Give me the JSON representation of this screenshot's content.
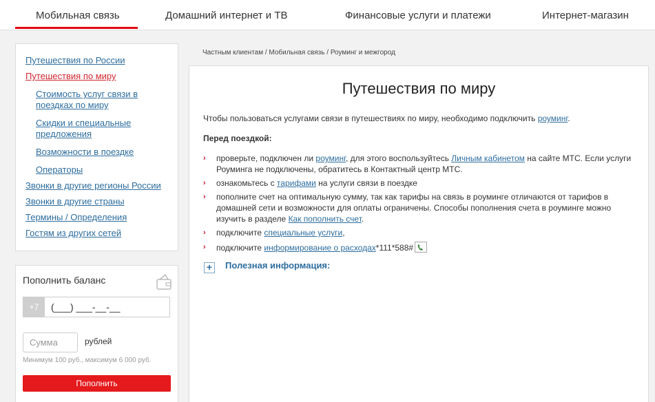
{
  "topnav": {
    "tabs": [
      {
        "label": "Мобильная связь"
      },
      {
        "label": "Домашний интернет и ТВ"
      },
      {
        "label": "Финансовые услуги и платежи"
      },
      {
        "label": "Интернет-магазин"
      }
    ]
  },
  "sidebar": {
    "items": [
      {
        "label": "Путешествия по России"
      },
      {
        "label": "Путешествия по миру"
      },
      {
        "label": "Стоимость услуг связи в поездках по миру"
      },
      {
        "label": "Скидки и специальные предложения"
      },
      {
        "label": "Возможности в поездке"
      },
      {
        "label": "Операторы"
      },
      {
        "label": "Звонки в другие регионы России"
      },
      {
        "label": "Звонки в другие страны"
      },
      {
        "label": "Термины / Определения"
      },
      {
        "label": "Гостям из других сетей"
      }
    ]
  },
  "balance": {
    "title": "Пополнить баланс",
    "prefix": "+7",
    "phone_mask": "(___) ___-__-__",
    "sum_placeholder": "Сумма",
    "currency": "рублей",
    "hint": "Минимум 100 руб., максимум 6 000 руб.",
    "button": "Пополнить"
  },
  "breadcrumb": {
    "items": [
      "Частным клиентам",
      "Мобильная связь",
      "Роуминг и межгород"
    ],
    "separator": " / "
  },
  "content": {
    "title": "Путешествия по миру",
    "intro": {
      "text": "Чтобы пользоваться услугами связи в путешествиях по миру, необходимо подключить ",
      "link": "роуминг",
      "end": "."
    },
    "before_title": "Перед поездкой:",
    "item1": {
      "a": "проверьте, подключен ли ",
      "link1": "роуминг",
      "b": ", для этого воспользуйтесь ",
      "link2": "Личным кабинетом",
      "c": " на сайте МТС. Если услуги Роуминга не подключены, обратитесь в Контактный центр МТС."
    },
    "item2": {
      "a": "ознакомьтесь с ",
      "link": "тарифами",
      "b": " на услуги связи в поездке"
    },
    "item3": {
      "a": "пополните счет на оптимальную сумму, так как тарифы на связь в роуминге отличаются от тарифов в домашней сети и возможности для оплаты ограничены. Способы пополнения счета в роуминге можно изучить в разделе ",
      "link": "Как пополнить счет",
      "b": "."
    },
    "item4": {
      "a": "подключите ",
      "link": "специальные услуги",
      "b": ","
    },
    "item5": {
      "a": "подключите ",
      "link": "информирование о расходах",
      "b": "*111*588#"
    },
    "useful": "Полезная информация:",
    "arrow": "›",
    "plus": "+"
  }
}
